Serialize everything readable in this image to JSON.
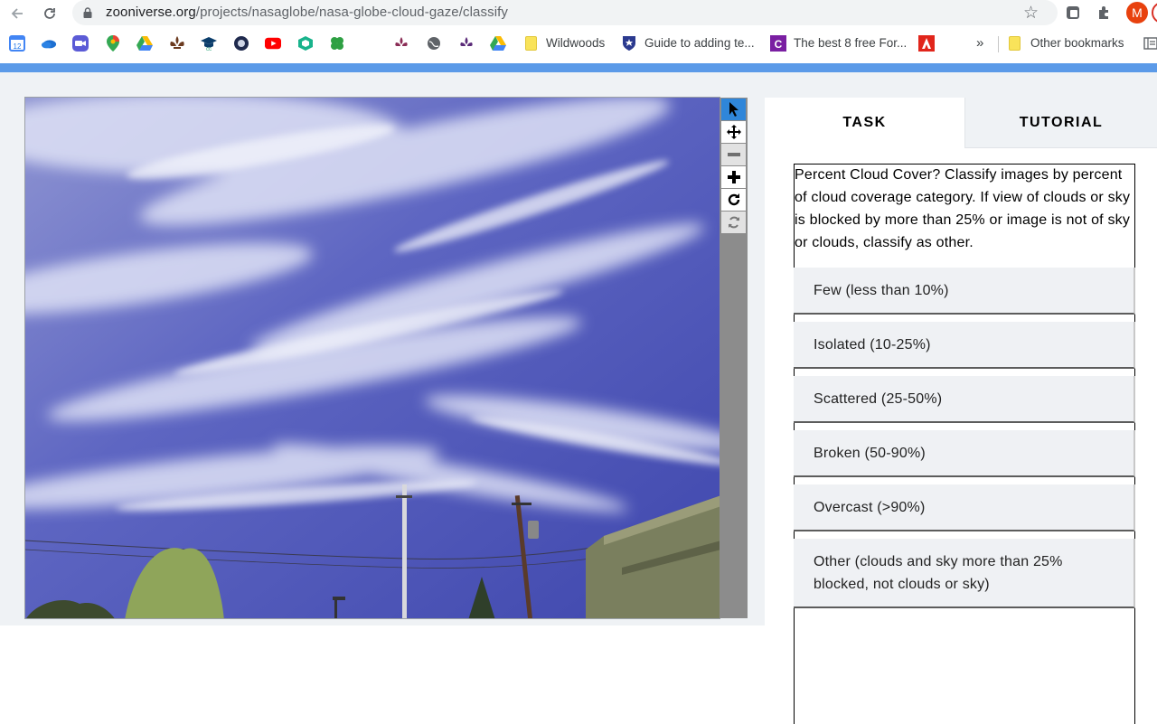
{
  "browser": {
    "url_host": "zooniverse.org",
    "url_path": "/projects/nasaglobe/nasa-globe-cloud-gaze/classify",
    "avatar_letter": "M",
    "calendar_day": "12",
    "bookmarks": [
      {
        "label": "Wildwoods",
        "icon": "folder-icon"
      },
      {
        "label": "Guide to adding te...",
        "icon": "crest-icon"
      },
      {
        "label": "The best 8 free For...",
        "icon": "c-logo-icon"
      },
      {
        "label": "",
        "icon": "adobe-icon"
      }
    ],
    "overflow_chevron": "»",
    "other_bookmarks_label": "Other bookmarks"
  },
  "viewer": {
    "tools": [
      {
        "name": "pointer-tool",
        "icon": "cursor-icon",
        "state": "active"
      },
      {
        "name": "pan-tool",
        "icon": "move-icon",
        "state": "normal"
      },
      {
        "name": "zoom-out-tool",
        "icon": "minus-icon",
        "state": "disabled"
      },
      {
        "name": "zoom-in-tool",
        "icon": "plus-icon",
        "state": "normal"
      },
      {
        "name": "rotate-tool",
        "icon": "rotate-icon",
        "state": "normal"
      },
      {
        "name": "reset-tool",
        "icon": "refresh-icon",
        "state": "disabled"
      }
    ]
  },
  "task_panel": {
    "tabs": [
      {
        "label": "TASK",
        "active": true
      },
      {
        "label": "TUTORIAL",
        "active": false
      }
    ],
    "question": "Percent Cloud Cover? Classify images by percent of cloud coverage category. If view of clouds or sky is blocked by more than 25% or image is not of sky or clouds, classify as other.",
    "answers": [
      "Few (less than 10%)",
      "Isolated (10-25%)",
      "Scattered (25-50%)",
      "Broken (50-90%)",
      "Overcast (>90%)",
      "Other (clouds and sky more than 25% blocked, not clouds or sky)"
    ]
  },
  "colors": {
    "accent_stripe": "#5b9ae8",
    "active_tool": "#2f86d9",
    "sky": "#4b55b8",
    "page_bg": "#eff2f5"
  }
}
